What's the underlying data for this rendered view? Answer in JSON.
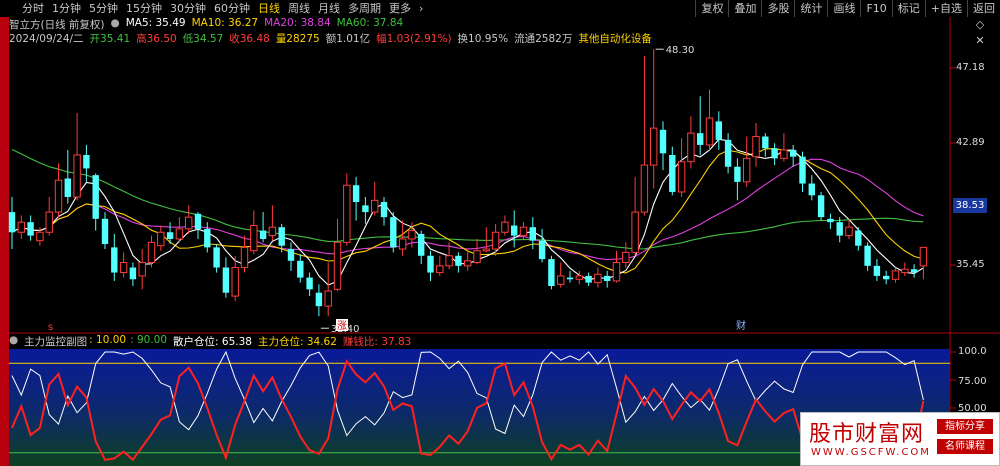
{
  "toolbar": {
    "period_tabs": [
      "分时",
      "1分钟",
      "5分钟",
      "15分钟",
      "30分钟",
      "60分钟",
      "日线",
      "周线",
      "月线",
      "多周期",
      "更多"
    ],
    "active_period_index": 6,
    "more_arrow": "›",
    "right_buttons": [
      "复权",
      "叠加",
      "多股",
      "统计",
      "画线",
      "F10",
      "标记",
      "+自选",
      "返回"
    ]
  },
  "right_column": {
    "items": [
      "◇",
      "✕"
    ]
  },
  "stock": {
    "name": "智立方(日线 前复权)",
    "ma5_label": "MA5: 35.49",
    "ma10_label": "MA10: 36.27",
    "ma20_label": "MA20: 38.84",
    "ma60_label": "MA60: 37.84",
    "date": "2024/09/24/二",
    "open": "开35.41",
    "high": "高36.50",
    "low": "低34.57",
    "close": "收36.48",
    "volume": "量28275",
    "amount": "额1.01亿",
    "change": "幅1.03(2.91%)",
    "turnover": "换10.95%",
    "float_shares": "流通2582万",
    "sector": "其他自动化设备"
  },
  "price_axis": {
    "ticks": [
      "47.18",
      "42.89",
      "35.45"
    ],
    "last_price": "38.53",
    "high_marker": "48.30",
    "low_marker": "32.40"
  },
  "chart_markers": {
    "s_marker": "s",
    "zhang_marker": "涨",
    "cai_marker": "财"
  },
  "sub_panel": {
    "name": "主力监控副图",
    "param1": ": 10.00",
    "param2": ": 90.00",
    "retail": "散户仓位: 65.38",
    "main": "主力仓位: 34.62",
    "ratio": "赚钱比: 37.83",
    "axis_ticks": [
      "100.0",
      "75.00",
      "50.00"
    ]
  },
  "watermark": {
    "title": "股市财富网",
    "url": "WWW.GSCFW.COM",
    "tag1": "指标分享",
    "tag2": "名师课程"
  },
  "colors": {
    "up": "#ff3c3c",
    "down": "#54ffff",
    "ma5": "#ffffff",
    "ma10": "#ffd200",
    "ma20": "#e040e0",
    "ma60": "#40c040",
    "retail_line": "#ffffff",
    "main_line": "#ff2020"
  },
  "chart_data": {
    "type": "candlestick",
    "candles": [
      [
        38.6,
        37.4,
        39.5,
        36.4
      ],
      [
        37.4,
        38.0,
        38.4,
        37.0
      ],
      [
        38.0,
        37.2,
        38.4,
        36.9
      ],
      [
        36.9,
        37.4,
        37.7,
        36.6
      ],
      [
        37.4,
        38.6,
        39.5,
        37.2
      ],
      [
        38.6,
        40.5,
        41.5,
        38.3
      ],
      [
        40.6,
        39.5,
        42.3,
        39.1
      ],
      [
        39.5,
        42.0,
        44.5,
        39.3
      ],
      [
        42.0,
        41.2,
        42.6,
        40.4
      ],
      [
        40.8,
        38.2,
        40.9,
        37.5
      ],
      [
        38.2,
        36.7,
        38.6,
        36.4
      ],
      [
        36.5,
        35.0,
        37.3,
        34.5
      ],
      [
        35.0,
        35.6,
        36.2,
        34.7
      ],
      [
        35.3,
        34.6,
        35.6,
        34.2
      ],
      [
        34.8,
        35.6,
        36.4,
        34.0
      ],
      [
        35.6,
        36.8,
        37.2,
        35.3
      ],
      [
        36.6,
        37.4,
        37.8,
        36.3
      ],
      [
        37.4,
        37.0,
        38.0,
        36.7
      ],
      [
        37.0,
        37.6,
        38.3,
        36.8
      ],
      [
        37.6,
        38.3,
        39.0,
        37.3
      ],
      [
        38.5,
        37.6,
        38.6,
        37.0
      ],
      [
        37.6,
        36.5,
        38.0,
        36.2
      ],
      [
        36.5,
        35.3,
        36.7,
        35.0
      ],
      [
        35.3,
        33.8,
        35.9,
        33.5
      ],
      [
        33.6,
        35.3,
        36.0,
        33.3
      ],
      [
        35.3,
        36.5,
        37.2,
        35.0
      ],
      [
        36.3,
        37.8,
        38.7,
        36.1
      ],
      [
        37.5,
        37.0,
        38.6,
        36.8
      ],
      [
        37.2,
        37.7,
        39.0,
        36.9
      ],
      [
        37.7,
        36.6,
        37.9,
        36.2
      ],
      [
        36.4,
        35.7,
        36.8,
        35.1
      ],
      [
        35.7,
        34.7,
        36.1,
        34.4
      ],
      [
        34.7,
        34.0,
        35.0,
        33.6
      ],
      [
        33.8,
        33.0,
        34.3,
        32.4
      ],
      [
        33.0,
        33.9,
        35.6,
        32.4
      ],
      [
        34.0,
        36.8,
        38.2,
        33.9
      ],
      [
        36.8,
        40.2,
        40.9,
        36.6
      ],
      [
        40.2,
        39.2,
        40.7,
        38.1
      ],
      [
        39.0,
        38.6,
        39.5,
        37.9
      ],
      [
        38.6,
        39.3,
        40.4,
        38.4
      ],
      [
        39.2,
        38.3,
        39.5,
        37.8
      ],
      [
        38.3,
        36.5,
        38.6,
        36.2
      ],
      [
        36.4,
        37.0,
        38.1,
        36.0
      ],
      [
        37.0,
        37.5,
        38.0,
        36.5
      ],
      [
        37.3,
        36.0,
        37.5,
        35.5
      ],
      [
        36.0,
        35.0,
        36.3,
        34.5
      ],
      [
        35.0,
        35.4,
        36.0,
        34.8
      ],
      [
        35.4,
        36.0,
        36.8,
        35.2
      ],
      [
        36.0,
        35.4,
        36.2,
        35.0
      ],
      [
        35.4,
        35.7,
        36.4,
        35.1
      ],
      [
        35.6,
        36.3,
        37.0,
        35.5
      ],
      [
        36.3,
        36.4,
        37.7,
        36.2
      ],
      [
        36.4,
        37.4,
        37.9,
        36.0
      ],
      [
        37.4,
        38.0,
        38.4,
        37.2
      ],
      [
        37.8,
        37.2,
        38.7,
        36.5
      ],
      [
        37.2,
        37.7,
        38.0,
        37.0
      ],
      [
        37.7,
        36.9,
        38.3,
        36.4
      ],
      [
        36.9,
        35.8,
        37.6,
        35.6
      ],
      [
        35.8,
        34.2,
        36.0,
        34.0
      ],
      [
        34.3,
        34.8,
        35.6,
        34.1
      ],
      [
        34.7,
        34.6,
        35.1,
        34.4
      ],
      [
        34.6,
        34.8,
        35.1,
        34.3
      ],
      [
        34.8,
        34.4,
        35.0,
        34.2
      ],
      [
        34.4,
        34.9,
        35.3,
        34.1
      ],
      [
        34.8,
        34.5,
        35.1,
        34.1
      ],
      [
        34.5,
        35.6,
        36.3,
        34.4
      ],
      [
        35.6,
        36.2,
        36.8,
        35.3
      ],
      [
        36.2,
        38.6,
        40.7,
        36.0
      ],
      [
        38.6,
        41.4,
        47.9,
        38.4
      ],
      [
        41.4,
        43.6,
        48.3,
        40.0
      ],
      [
        43.5,
        42.1,
        44.0,
        41.1
      ],
      [
        42.0,
        39.8,
        42.5,
        39.6
      ],
      [
        39.8,
        41.6,
        43.0,
        39.5
      ],
      [
        41.6,
        43.3,
        44.3,
        41.2
      ],
      [
        43.3,
        42.6,
        45.5,
        42.0
      ],
      [
        42.6,
        44.2,
        45.9,
        42.3
      ],
      [
        44.0,
        42.9,
        44.6,
        42.3
      ],
      [
        42.9,
        41.3,
        43.3,
        40.9
      ],
      [
        41.3,
        40.4,
        41.8,
        39.3
      ],
      [
        40.4,
        41.8,
        43.1,
        40.1
      ],
      [
        41.9,
        43.1,
        43.9,
        41.3
      ],
      [
        43.1,
        42.4,
        43.3,
        41.9
      ],
      [
        42.4,
        41.8,
        42.7,
        41.4
      ],
      [
        41.8,
        42.3,
        43.3,
        41.6
      ],
      [
        42.3,
        41.9,
        42.6,
        41.3
      ],
      [
        41.9,
        40.3,
        42.2,
        39.8
      ],
      [
        40.3,
        39.6,
        40.8,
        39.3
      ],
      [
        39.6,
        38.3,
        39.8,
        38.1
      ],
      [
        38.2,
        38.0,
        38.5,
        37.6
      ],
      [
        38.0,
        37.2,
        38.3,
        36.8
      ],
      [
        37.2,
        37.7,
        38.2,
        37.0
      ],
      [
        37.5,
        36.6,
        37.7,
        36.3
      ],
      [
        36.6,
        35.4,
        36.8,
        35.1
      ],
      [
        35.4,
        34.8,
        35.8,
        34.5
      ],
      [
        34.8,
        34.6,
        35.1,
        34.3
      ],
      [
        34.6,
        35.1,
        35.3,
        34.4
      ],
      [
        35.0,
        35.2,
        35.6,
        34.8
      ],
      [
        35.2,
        35.0,
        35.5,
        34.7
      ],
      [
        35.4,
        36.5,
        36.5,
        34.6
      ]
    ]
  }
}
